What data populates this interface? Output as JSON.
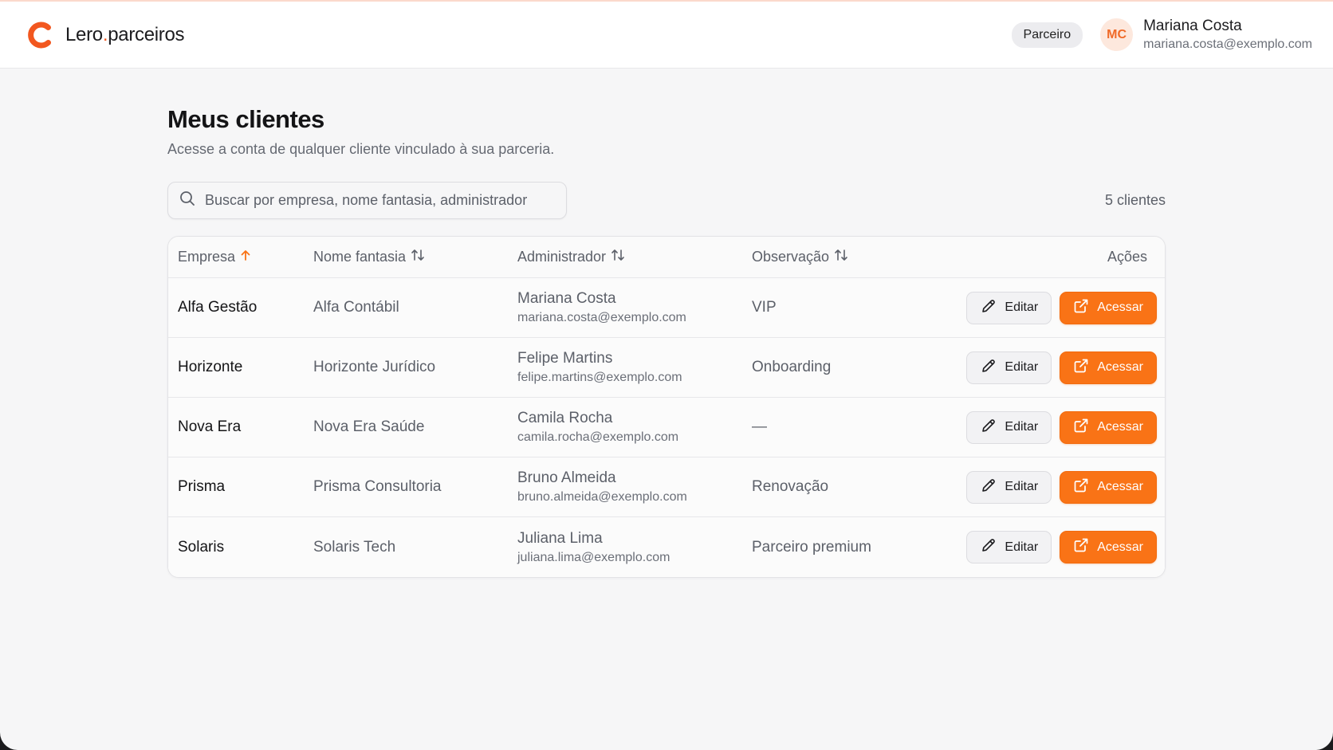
{
  "header": {
    "brand_name": "Lero",
    "brand_dot": ".",
    "brand_suffix": "parceiros",
    "role_badge": "Parceiro",
    "user": {
      "initials": "MC",
      "name": "Mariana Costa",
      "email": "mariana.costa@exemplo.com"
    }
  },
  "page": {
    "title": "Meus clientes",
    "subtitle": "Acesse a conta de qualquer cliente vinculado à sua parceria."
  },
  "search": {
    "placeholder": "Buscar por empresa, nome fantasia, administrador",
    "value": ""
  },
  "count_label": "5 clientes",
  "table": {
    "headers": {
      "empresa": "Empresa",
      "fantasia": "Nome fantasia",
      "admin": "Administrador",
      "obs": "Observação",
      "acoes": "Ações"
    },
    "sort": {
      "active_column": "empresa",
      "direction": "asc"
    },
    "rows": [
      {
        "empresa": "Alfa Gestão",
        "fantasia": "Alfa Contábil",
        "admin_name": "Mariana Costa",
        "admin_email": "mariana.costa@exemplo.com",
        "obs": "VIP"
      },
      {
        "empresa": "Horizonte",
        "fantasia": "Horizonte Jurídico",
        "admin_name": "Felipe Martins",
        "admin_email": "felipe.martins@exemplo.com",
        "obs": "Onboarding"
      },
      {
        "empresa": "Nova Era",
        "fantasia": "Nova Era Saúde",
        "admin_name": "Camila Rocha",
        "admin_email": "camila.rocha@exemplo.com",
        "obs": "—"
      },
      {
        "empresa": "Prisma",
        "fantasia": "Prisma Consultoria",
        "admin_name": "Bruno Almeida",
        "admin_email": "bruno.almeida@exemplo.com",
        "obs": "Renovação"
      },
      {
        "empresa": "Solaris",
        "fantasia": "Solaris Tech",
        "admin_name": "Juliana Lima",
        "admin_email": "juliana.lima@exemplo.com",
        "obs": "Parceiro premium"
      }
    ],
    "actions": {
      "edit_label": "Editar",
      "access_label": "Acessar"
    }
  },
  "icons": {
    "logo": "logo-icon",
    "search": "search-icon",
    "sort_asc": "arrow-up-icon",
    "sort_both": "sort-arrows-icon",
    "edit": "pencil-icon",
    "access": "external-link-icon"
  },
  "colors": {
    "accent": "#f97316",
    "brand": "#f2571f",
    "avatar_bg": "#fde8dd",
    "avatar_text": "#f06a28"
  }
}
